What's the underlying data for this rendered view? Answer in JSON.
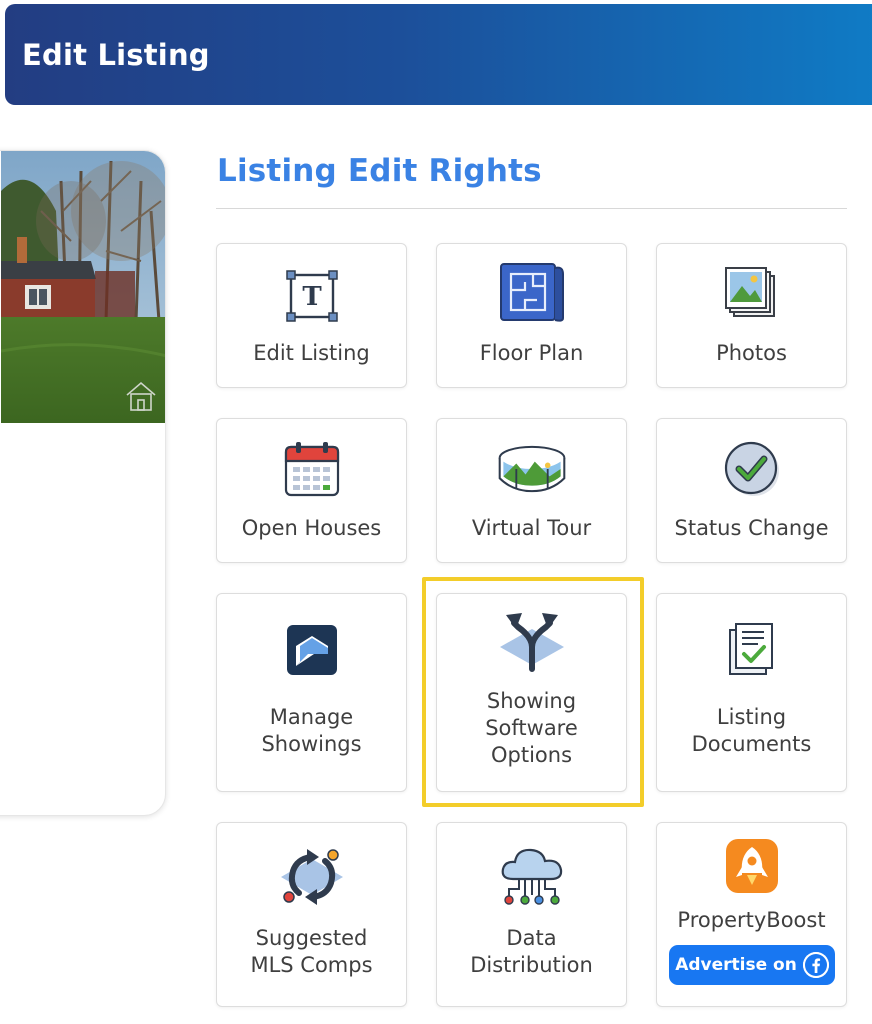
{
  "header": {
    "title": "Edit Listing"
  },
  "section": {
    "title": "Listing Edit Rights"
  },
  "tiles": [
    {
      "label": "Edit Listing",
      "icon": "text-frame-icon"
    },
    {
      "label": "Floor Plan",
      "icon": "blueprint-icon"
    },
    {
      "label": "Photos",
      "icon": "photo-stack-icon"
    },
    {
      "label": "Open Houses",
      "icon": "calendar-icon"
    },
    {
      "label": "Virtual Tour",
      "icon": "panorama-icon"
    },
    {
      "label": "Status Change",
      "icon": "check-circle-icon"
    },
    {
      "label_line1": "Manage",
      "label_line2": "Showings",
      "icon": "showings-logo-icon"
    },
    {
      "label_line1": "Showing",
      "label_line2": "Software",
      "label_line3": "Options",
      "icon": "branching-arrows-icon"
    },
    {
      "label_line1": "Listing",
      "label_line2": "Documents",
      "icon": "documents-check-icon"
    },
    {
      "label_line1": "Suggested",
      "label_line2": "MLS Comps",
      "icon": "sync-arrows-icon"
    },
    {
      "label_line1": "Data",
      "label_line2": "Distribution",
      "icon": "cloud-network-icon"
    },
    {
      "label": "PropertyBoost",
      "icon": "rocket-icon",
      "button_label": "Advertise on"
    }
  ],
  "colors": {
    "header_start": "#233d82",
    "header_end": "#0f7cc6",
    "title_blue": "#3a82e4",
    "highlight": "#f3cd2a",
    "facebook_blue": "#1877f2"
  }
}
